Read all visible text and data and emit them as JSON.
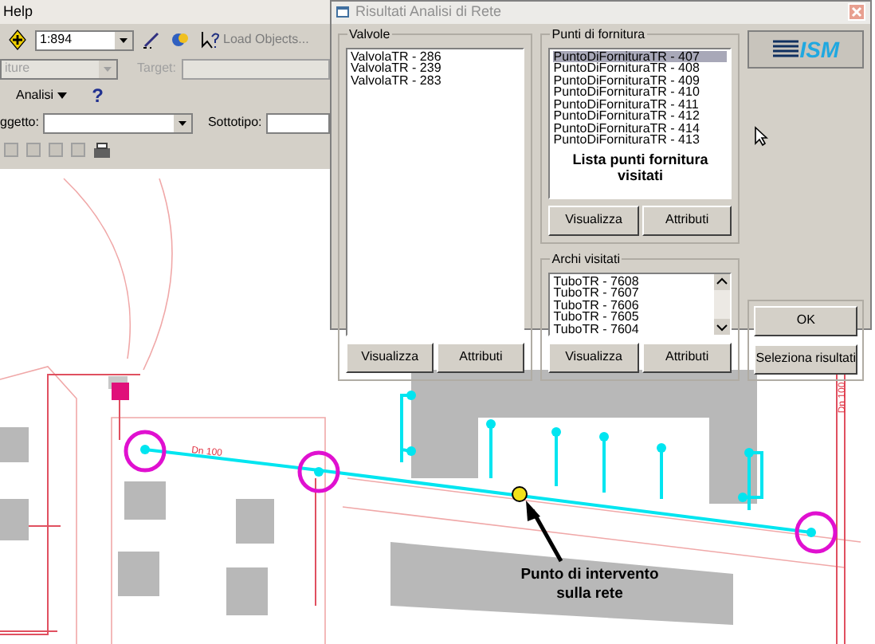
{
  "menu": {
    "items": [
      "Help"
    ]
  },
  "toolbar": {
    "scale": "1:894",
    "load_objects": {
      "label": "Load Objects...",
      "disabled": true
    }
  },
  "filter_row": {
    "layer": {
      "value": "iture",
      "disabled": true
    },
    "target": {
      "label": "Target:",
      "disabled": true
    }
  },
  "analysis": {
    "menu_label": "Analisi",
    "help_label": "?"
  },
  "object_row": {
    "object_label": "ggetto:",
    "subtype_label": "Sottotipo:"
  },
  "dialog": {
    "title": "Risultati Analisi di Rete",
    "valves": {
      "title": "Valvole",
      "items": [
        {
          "label": "ValvolaTR - 286",
          "selected": false
        },
        {
          "label": "ValvolaTR - 239",
          "selected": false
        },
        {
          "label": "ValvolaTR - 283",
          "selected": false
        }
      ],
      "buttons": [
        "Visualizza",
        "Attributi"
      ]
    },
    "supply_points": {
      "title": "Punti di fornitura",
      "items": [
        {
          "label": "PuntoDiFornituraTR - 407",
          "selected": true
        },
        {
          "label": "PuntoDiFornituraTR - 408",
          "selected": false
        },
        {
          "label": "PuntoDiFornituraTR - 409",
          "selected": false
        },
        {
          "label": "PuntoDiFornituraTR - 410",
          "selected": false
        },
        {
          "label": "PuntoDiFornituraTR - 411",
          "selected": false
        },
        {
          "label": "PuntoDiFornituraTR - 412",
          "selected": false
        },
        {
          "label": "PuntoDiFornituraTR - 414",
          "selected": false
        },
        {
          "label": "PuntoDiFornituraTR - 413",
          "selected": false
        }
      ],
      "caption": "Lista punti fornitura visitati",
      "buttons": [
        "Visualizza",
        "Attributi"
      ]
    },
    "visited_arcs": {
      "title": "Archi visitati",
      "items": [
        {
          "label": "TuboTR - 7608",
          "selected": false
        },
        {
          "label": "TuboTR - 7607",
          "selected": false
        },
        {
          "label": "TuboTR - 7606",
          "selected": false
        },
        {
          "label": "TuboTR - 7605",
          "selected": false
        },
        {
          "label": "TuboTR - 7604",
          "selected": false
        }
      ],
      "buttons": [
        "Visualizza",
        "Attributi"
      ]
    },
    "logo": {
      "text": "ISM"
    },
    "actions": [
      "OK",
      "Seleziona risultati"
    ]
  },
  "map": {
    "pipe_labels": [
      "Dn 100",
      "Dn 100"
    ],
    "callout": "Punto di intervento sulla rete"
  }
}
